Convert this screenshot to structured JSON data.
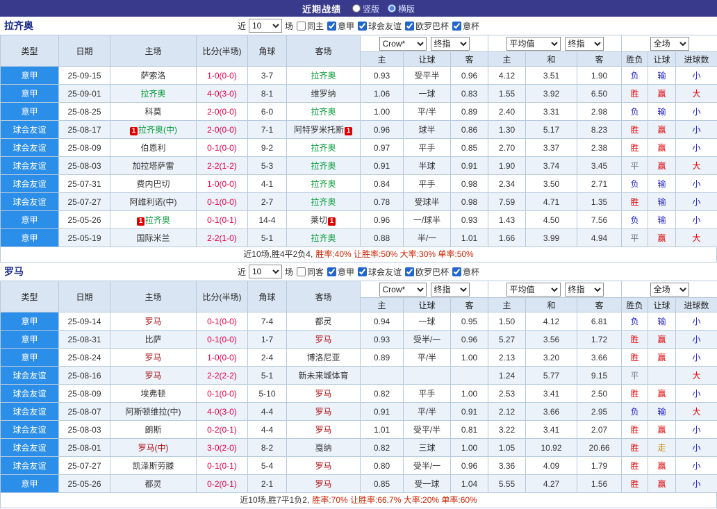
{
  "topbar": {
    "title": "近期战绩",
    "layout_options": [
      {
        "label": "竖版",
        "selected": false
      },
      {
        "label": "横版",
        "selected": true
      }
    ]
  },
  "red_card_badge": "1",
  "colors": {
    "topbar_bg": "#3a3a8c",
    "league_cell_bg": "#2b8ee8",
    "header_bg": "#d9e5f2",
    "alt_row_bg": "#ebf2fa",
    "border": "#b7c9dd",
    "score_text": "#e60045",
    "focus_team_0": "#009933",
    "focus_team_1": "#b01111",
    "result_map": {
      "胜": "#e60000",
      "负": "#2222cc",
      "平": "#708090",
      "赢": "#e60000",
      "输": "#2222cc",
      "走": "#cc8800",
      "大": "#e60000",
      "小": "#2222cc"
    }
  },
  "table": {
    "main_columns": [
      "类型",
      "日期",
      "主场",
      "比分(半场)",
      "角球",
      "客场"
    ],
    "sub_columns": [
      "主",
      "让球",
      "客",
      "主",
      "和",
      "客",
      "胜负",
      "让球",
      "进球数"
    ]
  },
  "sections": [
    {
      "team": "拉齐奥",
      "filter": {
        "near_label": "近",
        "count": "10",
        "unit_label": "场",
        "same_option": {
          "label": "同主",
          "checked": false
        },
        "leagues": [
          {
            "label": "意甲",
            "checked": true
          },
          {
            "label": "球会友谊",
            "checked": true
          },
          {
            "label": "欧罗巴杯",
            "checked": true
          },
          {
            "label": "意杯",
            "checked": true
          }
        ]
      },
      "dropdowns": {
        "asia_source": "Crow*",
        "asia_type": "终指",
        "europe_source": "平均值",
        "europe_type": "终指",
        "scope": "全场"
      },
      "rows": [
        {
          "league": "意甲",
          "date": "25-09-15",
          "home": {
            "name": "萨索洛"
          },
          "score": "1-0(0-0)",
          "corner": "3-7",
          "away": {
            "name": "拉齐奥",
            "focus": true
          },
          "asia": [
            "0.93",
            "受平半",
            "0.96"
          ],
          "europe": [
            "4.12",
            "3.51",
            "1.90"
          ],
          "result": [
            "负",
            "输",
            "小"
          ]
        },
        {
          "league": "意甲",
          "date": "25-09-01",
          "home": {
            "name": "拉齐奥",
            "focus": true
          },
          "score": "4-0(3-0)",
          "corner": "8-1",
          "away": {
            "name": "维罗纳"
          },
          "asia": [
            "1.06",
            "一球",
            "0.83"
          ],
          "europe": [
            "1.55",
            "3.92",
            "6.50"
          ],
          "result": [
            "胜",
            "赢",
            "大"
          ]
        },
        {
          "league": "意甲",
          "date": "25-08-25",
          "home": {
            "name": "科莫"
          },
          "score": "2-0(0-0)",
          "corner": "6-0",
          "away": {
            "name": "拉齐奥",
            "focus": true
          },
          "asia": [
            "1.00",
            "平/半",
            "0.89"
          ],
          "europe": [
            "2.40",
            "3.31",
            "2.98"
          ],
          "result": [
            "负",
            "输",
            "小"
          ]
        },
        {
          "league": "球会友谊",
          "date": "25-08-17",
          "home": {
            "name": "拉齐奥(中)",
            "focus": true,
            "red_card_left": true
          },
          "score": "2-0(0-0)",
          "corner": "7-1",
          "away": {
            "name": "阿特罗米托斯",
            "red_card_right": true
          },
          "asia": [
            "0.96",
            "球半",
            "0.86"
          ],
          "europe": [
            "1.30",
            "5.17",
            "8.23"
          ],
          "result": [
            "胜",
            "赢",
            "小"
          ]
        },
        {
          "league": "球会友谊",
          "date": "25-08-09",
          "home": {
            "name": "伯恩利"
          },
          "score": "0-1(0-0)",
          "corner": "9-2",
          "away": {
            "name": "拉齐奥",
            "focus": true
          },
          "asia": [
            "0.97",
            "平手",
            "0.85"
          ],
          "europe": [
            "2.70",
            "3.37",
            "2.38"
          ],
          "result": [
            "胜",
            "赢",
            "小"
          ]
        },
        {
          "league": "球会友谊",
          "date": "25-08-03",
          "home": {
            "name": "加拉塔萨雷"
          },
          "score": "2-2(1-2)",
          "corner": "5-3",
          "away": {
            "name": "拉齐奥",
            "focus": true
          },
          "asia": [
            "0.91",
            "半球",
            "0.91"
          ],
          "europe": [
            "1.90",
            "3.74",
            "3.45"
          ],
          "result": [
            "平",
            "赢",
            "大"
          ]
        },
        {
          "league": "球会友谊",
          "date": "25-07-31",
          "home": {
            "name": "费内巴切"
          },
          "score": "1-0(0-0)",
          "corner": "4-1",
          "away": {
            "name": "拉齐奥",
            "focus": true
          },
          "asia": [
            "0.84",
            "平手",
            "0.98"
          ],
          "europe": [
            "2.34",
            "3.50",
            "2.71"
          ],
          "result": [
            "负",
            "输",
            "小"
          ]
        },
        {
          "league": "球会友谊",
          "date": "25-07-27",
          "home": {
            "name": "阿维利诺(中)"
          },
          "score": "0-1(0-0)",
          "corner": "2-7",
          "away": {
            "name": "拉齐奥",
            "focus": true
          },
          "asia": [
            "0.78",
            "受球半",
            "0.98"
          ],
          "europe": [
            "7.59",
            "4.71",
            "1.35"
          ],
          "result": [
            "胜",
            "输",
            "小"
          ]
        },
        {
          "league": "意甲",
          "date": "25-05-26",
          "home": {
            "name": "拉齐奥",
            "focus": true,
            "red_card_left": true
          },
          "score": "0-1(0-1)",
          "corner": "14-4",
          "away": {
            "name": "莱切",
            "red_card_right": true
          },
          "asia": [
            "0.96",
            "一/球半",
            "0.93"
          ],
          "europe": [
            "1.43",
            "4.50",
            "7.56"
          ],
          "result": [
            "负",
            "输",
            "小"
          ]
        },
        {
          "league": "意甲",
          "date": "25-05-19",
          "home": {
            "name": "国际米兰"
          },
          "score": "2-2(1-0)",
          "corner": "5-1",
          "away": {
            "name": "拉齐奥",
            "focus": true
          },
          "asia": [
            "0.88",
            "半/一",
            "1.01"
          ],
          "europe": [
            "1.66",
            "3.99",
            "4.94"
          ],
          "result": [
            "平",
            "赢",
            "大"
          ]
        }
      ],
      "summary": {
        "prefix": "近10场,胜4平2负4,",
        "stats": "胜率:40% 让胜率:50% 大率:30% 单率:50%"
      }
    },
    {
      "team": "罗马",
      "filter": {
        "near_label": "近",
        "count": "10",
        "unit_label": "场",
        "same_option": {
          "label": "同客",
          "checked": false
        },
        "leagues": [
          {
            "label": "意甲",
            "checked": true
          },
          {
            "label": "球会友谊",
            "checked": true
          },
          {
            "label": "欧罗巴杯",
            "checked": true
          },
          {
            "label": "意杯",
            "checked": true
          }
        ]
      },
      "dropdowns": {
        "asia_source": "Crow*",
        "asia_type": "终指",
        "europe_source": "平均值",
        "europe_type": "终指",
        "scope": "全场"
      },
      "rows": [
        {
          "league": "意甲",
          "date": "25-09-14",
          "home": {
            "name": "罗马",
            "focus": true
          },
          "score": "0-1(0-0)",
          "corner": "7-4",
          "away": {
            "name": "都灵"
          },
          "asia": [
            "0.94",
            "一球",
            "0.95"
          ],
          "europe": [
            "1.50",
            "4.12",
            "6.81"
          ],
          "result": [
            "负",
            "输",
            "小"
          ]
        },
        {
          "league": "意甲",
          "date": "25-08-31",
          "home": {
            "name": "比萨"
          },
          "score": "0-1(0-0)",
          "corner": "1-7",
          "away": {
            "name": "罗马",
            "focus": true
          },
          "asia": [
            "0.93",
            "受半/一",
            "0.96"
          ],
          "europe": [
            "5.27",
            "3.56",
            "1.72"
          ],
          "result": [
            "胜",
            "赢",
            "小"
          ]
        },
        {
          "league": "意甲",
          "date": "25-08-24",
          "home": {
            "name": "罗马",
            "focus": true
          },
          "score": "1-0(0-0)",
          "corner": "2-4",
          "away": {
            "name": "博洛尼亚"
          },
          "asia": [
            "0.89",
            "平/半",
            "1.00"
          ],
          "europe": [
            "2.13",
            "3.20",
            "3.66"
          ],
          "result": [
            "胜",
            "赢",
            "小"
          ]
        },
        {
          "league": "球会友谊",
          "date": "25-08-16",
          "home": {
            "name": "罗马",
            "focus": true
          },
          "score": "2-2(2-2)",
          "corner": "5-1",
          "away": {
            "name": "新未来城体育"
          },
          "asia": [
            "",
            "",
            ""
          ],
          "europe": [
            "1.24",
            "5.77",
            "9.15"
          ],
          "result": [
            "平",
            "",
            "大"
          ]
        },
        {
          "league": "球会友谊",
          "date": "25-08-09",
          "home": {
            "name": "埃弗顿"
          },
          "score": "0-1(0-0)",
          "corner": "5-10",
          "away": {
            "name": "罗马",
            "focus": true
          },
          "asia": [
            "0.82",
            "平手",
            "1.00"
          ],
          "europe": [
            "2.53",
            "3.41",
            "2.50"
          ],
          "result": [
            "胜",
            "赢",
            "小"
          ]
        },
        {
          "league": "球会友谊",
          "date": "25-08-07",
          "home": {
            "name": "阿斯顿维拉(中)"
          },
          "score": "4-0(3-0)",
          "corner": "4-4",
          "away": {
            "name": "罗马",
            "focus": true
          },
          "asia": [
            "0.91",
            "平/半",
            "0.91"
          ],
          "europe": [
            "2.12",
            "3.66",
            "2.95"
          ],
          "result": [
            "负",
            "输",
            "大"
          ]
        },
        {
          "league": "球会友谊",
          "date": "25-08-03",
          "home": {
            "name": "朗斯"
          },
          "score": "0-2(0-1)",
          "corner": "4-4",
          "away": {
            "name": "罗马",
            "focus": true
          },
          "asia": [
            "1.01",
            "受平/半",
            "0.81"
          ],
          "europe": [
            "3.22",
            "3.41",
            "2.07"
          ],
          "result": [
            "胜",
            "赢",
            "小"
          ]
        },
        {
          "league": "球会友谊",
          "date": "25-08-01",
          "home": {
            "name": "罗马(中)",
            "focus": true
          },
          "score": "3-0(2-0)",
          "corner": "8-2",
          "away": {
            "name": "戛纳"
          },
          "asia": [
            "0.82",
            "三球",
            "1.00"
          ],
          "europe": [
            "1.05",
            "10.92",
            "20.66"
          ],
          "result": [
            "胜",
            "走",
            "小"
          ]
        },
        {
          "league": "球会友谊",
          "date": "25-07-27",
          "home": {
            "name": "凯泽斯劳滕"
          },
          "score": "0-1(0-1)",
          "corner": "5-4",
          "away": {
            "name": "罗马",
            "focus": true
          },
          "asia": [
            "0.80",
            "受半/一",
            "0.96"
          ],
          "europe": [
            "3.36",
            "4.09",
            "1.79"
          ],
          "result": [
            "胜",
            "赢",
            "小"
          ]
        },
        {
          "league": "意甲",
          "date": "25-05-26",
          "home": {
            "name": "都灵"
          },
          "score": "0-2(0-1)",
          "corner": "2-1",
          "away": {
            "name": "罗马",
            "focus": true
          },
          "asia": [
            "0.85",
            "受一球",
            "1.04"
          ],
          "europe": [
            "5.55",
            "4.27",
            "1.56"
          ],
          "result": [
            "胜",
            "赢",
            "小"
          ]
        }
      ],
      "summary": {
        "prefix": "近10场,胜7平1负2,",
        "stats": "胜率:70% 让胜率:66.7% 大率:20% 单率:60%"
      }
    }
  ]
}
